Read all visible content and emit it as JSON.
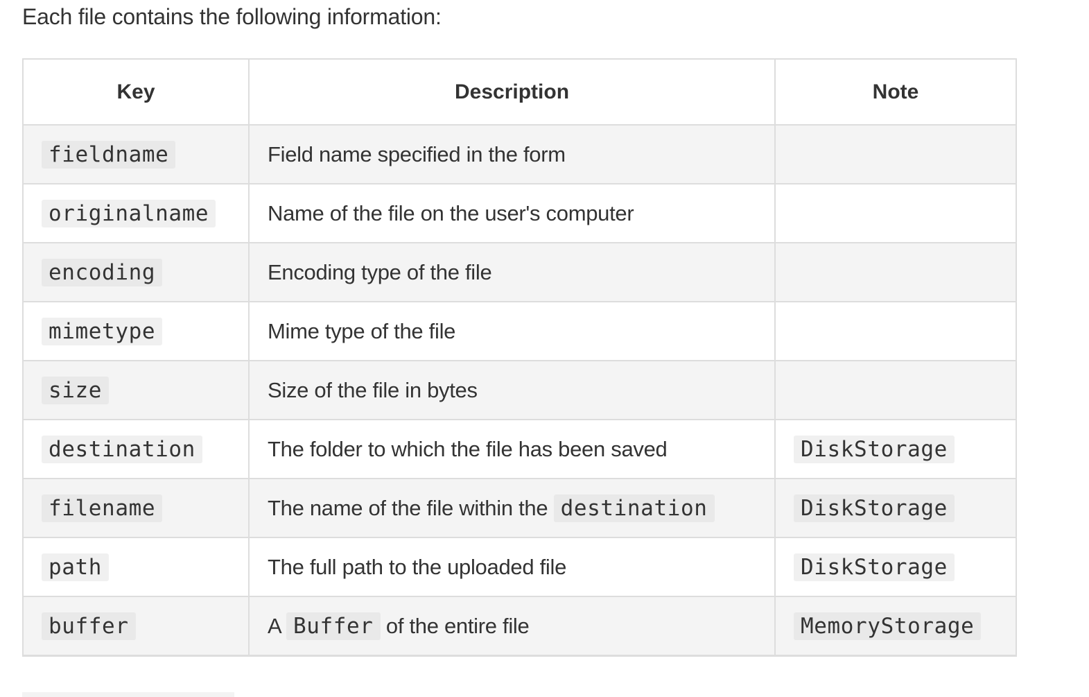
{
  "intro": "Each file contains the following information:",
  "table": {
    "headers": [
      "Key",
      "Description",
      "Note"
    ],
    "rows": [
      {
        "key": "fieldname",
        "desc_before": "Field name specified in the form",
        "desc_code": "",
        "desc_after": "",
        "note": ""
      },
      {
        "key": "originalname",
        "desc_before": "Name of the file on the user's computer",
        "desc_code": "",
        "desc_after": "",
        "note": ""
      },
      {
        "key": "encoding",
        "desc_before": "Encoding type of the file",
        "desc_code": "",
        "desc_after": "",
        "note": ""
      },
      {
        "key": "mimetype",
        "desc_before": "Mime type of the file",
        "desc_code": "",
        "desc_after": "",
        "note": ""
      },
      {
        "key": "size",
        "desc_before": "Size of the file in bytes",
        "desc_code": "",
        "desc_after": "",
        "note": ""
      },
      {
        "key": "destination",
        "desc_before": "The folder to which the file has been saved",
        "desc_code": "",
        "desc_after": "",
        "note": "DiskStorage"
      },
      {
        "key": "filename",
        "desc_before": "The name of the file within the ",
        "desc_code": "destination",
        "desc_after": "",
        "note": "DiskStorage"
      },
      {
        "key": "path",
        "desc_before": "The full path to the uploaded file",
        "desc_code": "",
        "desc_after": "",
        "note": "DiskStorage"
      },
      {
        "key": "buffer",
        "desc_before": "A ",
        "desc_code": "Buffer",
        "desc_after": " of the entire file",
        "note": "MemoryStorage"
      }
    ]
  }
}
